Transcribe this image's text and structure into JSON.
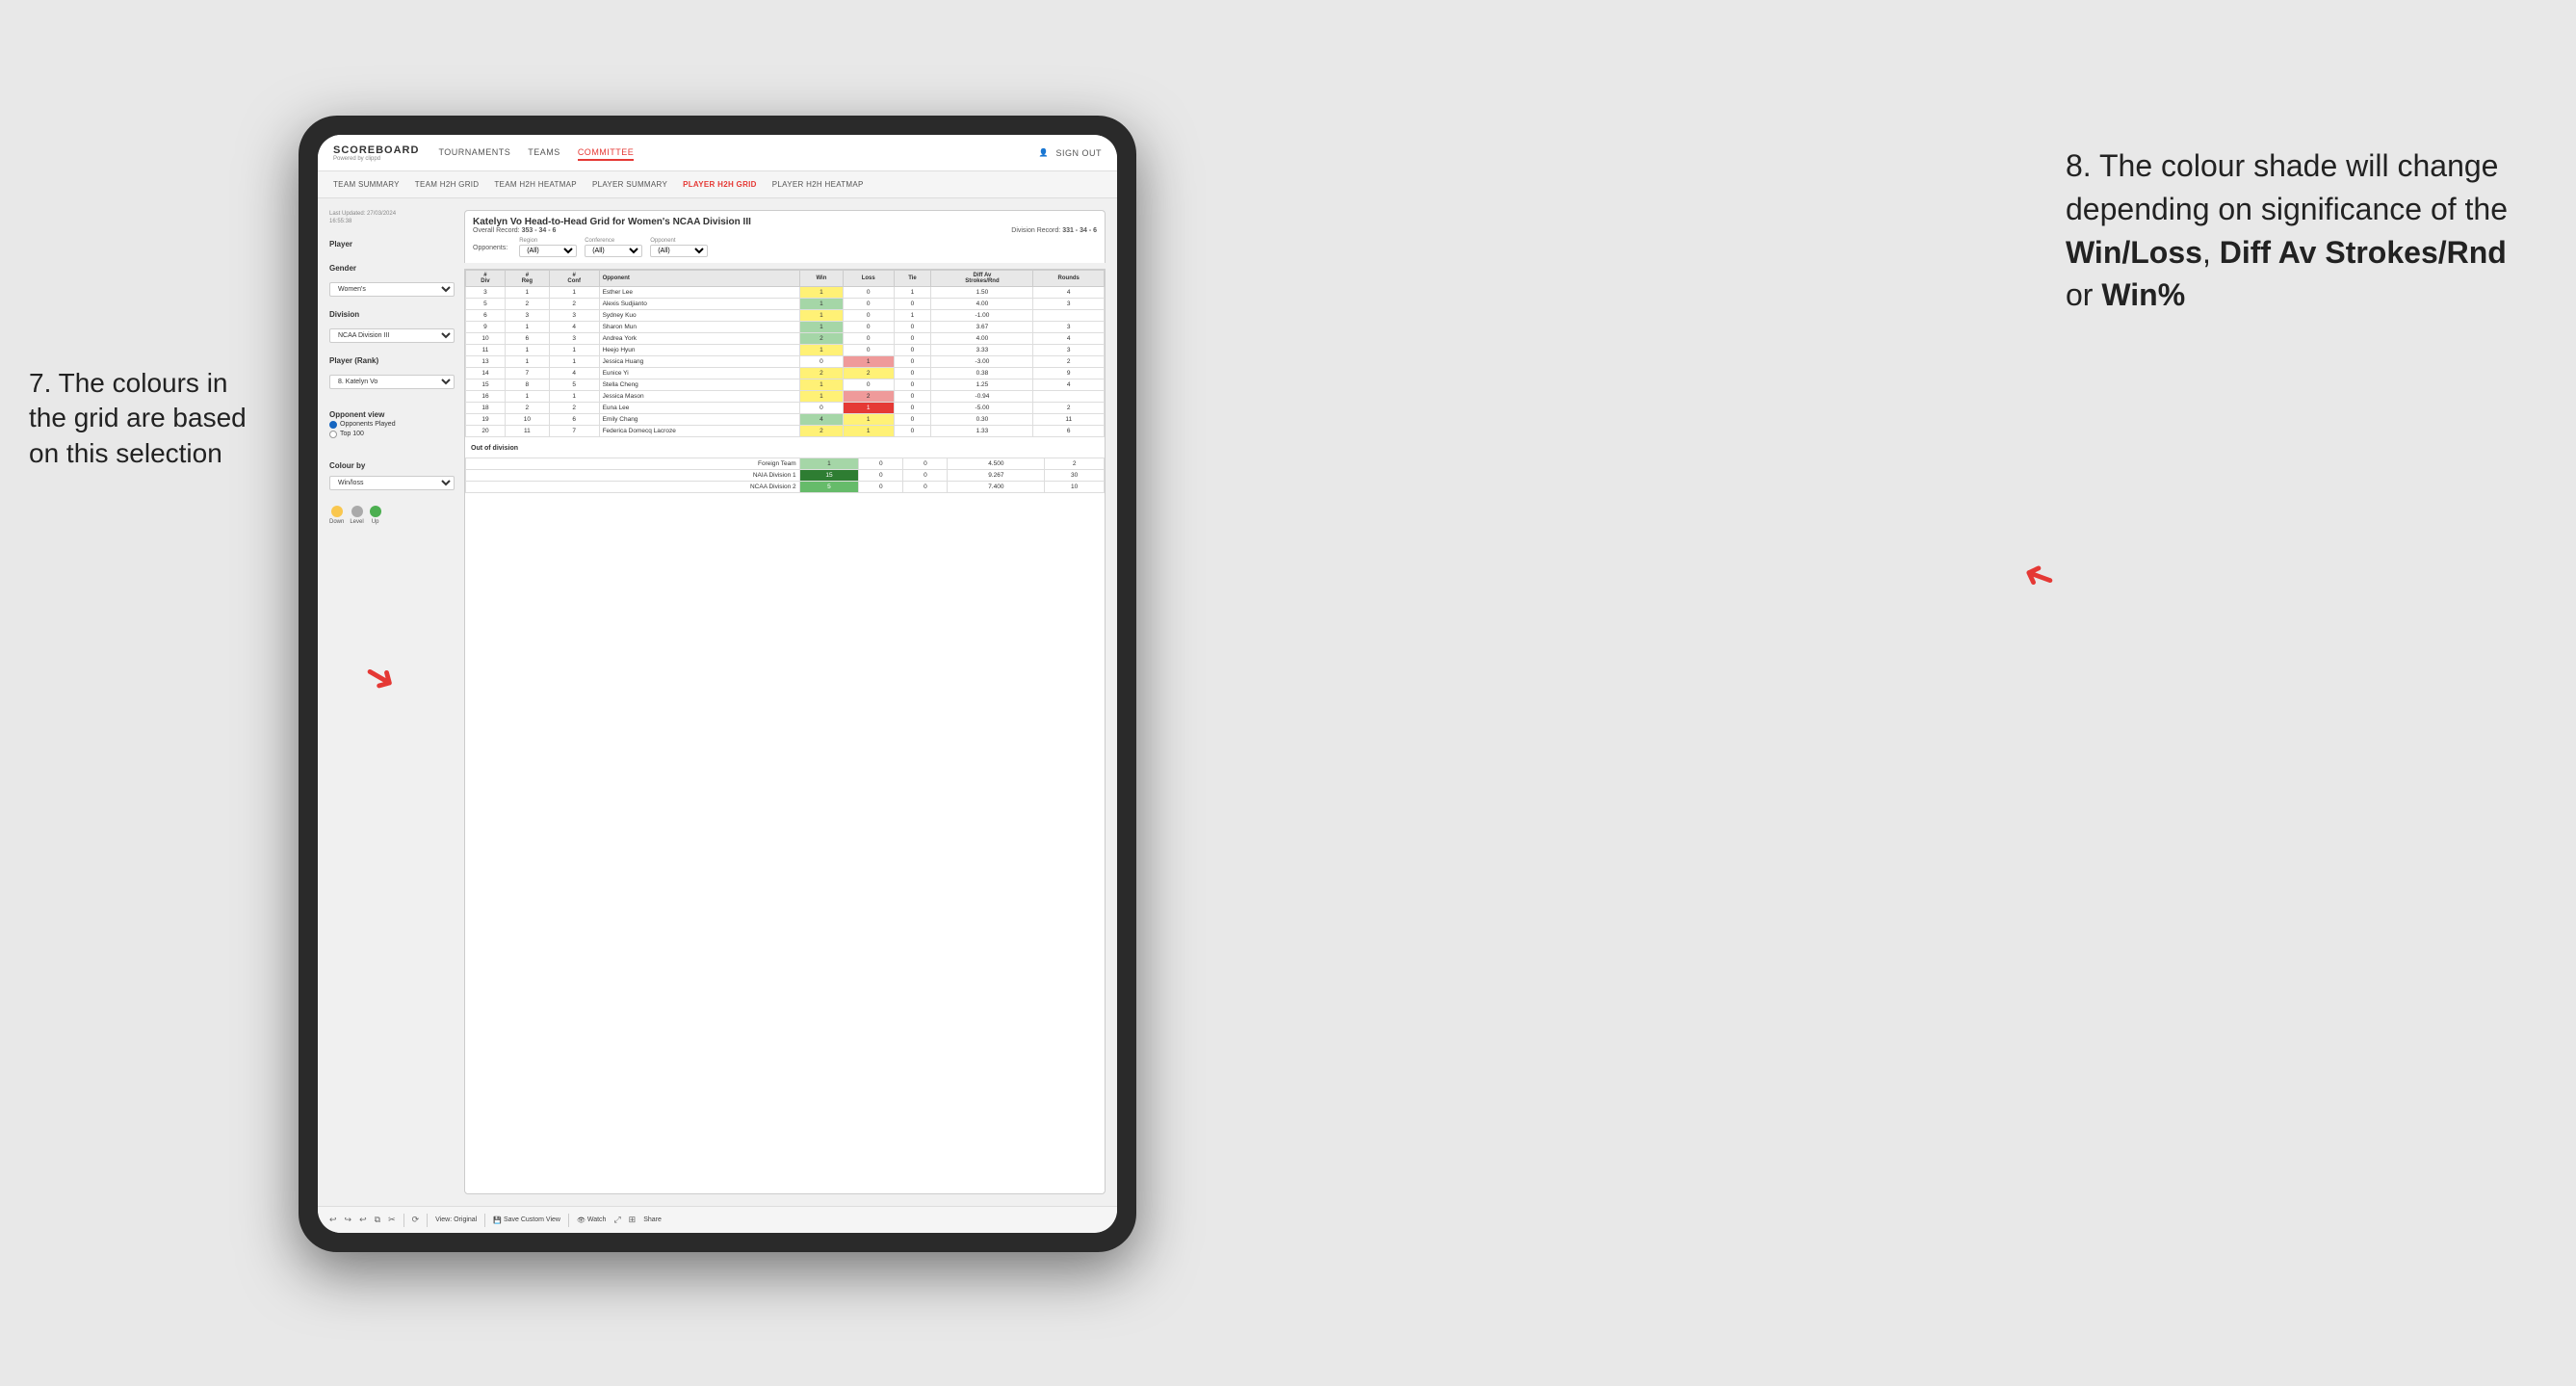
{
  "annotations": {
    "left": {
      "line1": "7. The colours in",
      "line2": "the grid are based",
      "line3": "on this selection"
    },
    "right": {
      "intro": "8. The colour shade will change depending on significance of the ",
      "bold1": "Win/Loss",
      "sep1": ", ",
      "bold2": "Diff Av Strokes/Rnd",
      "sep2": " or ",
      "bold3": "Win%"
    }
  },
  "header": {
    "logo": "SCOREBOARD",
    "logo_sub": "Powered by clippd",
    "nav": [
      "TOURNAMENTS",
      "TEAMS",
      "COMMITTEE"
    ],
    "active_nav": "COMMITTEE",
    "sign_in_label": "Sign out"
  },
  "sub_nav": {
    "items": [
      "TEAM SUMMARY",
      "TEAM H2H GRID",
      "TEAM H2H HEATMAP",
      "PLAYER SUMMARY",
      "PLAYER H2H GRID",
      "PLAYER H2H HEATMAP"
    ],
    "active": "PLAYER H2H GRID"
  },
  "left_panel": {
    "last_updated": "Last Updated: 27/03/2024\n16:55:38",
    "player_label": "Player",
    "gender_label": "Gender",
    "gender_value": "Women's",
    "division_label": "Division",
    "division_value": "NCAA Division III",
    "player_rank_label": "Player (Rank)",
    "player_rank_value": "8. Katelyn Vo",
    "opponent_view_label": "Opponent view",
    "radio1": "Opponents Played",
    "radio2": "Top 100",
    "colour_by_label": "Colour by",
    "colour_by_value": "Win/loss",
    "legend": {
      "down_label": "Down",
      "level_label": "Level",
      "up_label": "Up",
      "down_color": "#f9c74f",
      "level_color": "#aaa",
      "up_color": "#4caf50"
    }
  },
  "grid": {
    "title": "Katelyn Vo Head-to-Head Grid for Women's NCAA Division III",
    "overall_record_label": "Overall Record:",
    "overall_record": "353 - 34 - 6",
    "division_record_label": "Division Record:",
    "division_record": "331 - 34 - 6",
    "filters": {
      "opponents_label": "Opponents:",
      "region_label": "Region",
      "region_value": "(All)",
      "conference_label": "Conference",
      "conference_value": "(All)",
      "opponent_label": "Opponent",
      "opponent_value": "(All)"
    },
    "table_headers": [
      "#\nDiv",
      "#\nReg",
      "#\nConf",
      "Opponent",
      "Win",
      "Loss",
      "Tie",
      "Diff Av\nStrokes/Rnd",
      "Rounds"
    ],
    "rows": [
      {
        "div": "3",
        "reg": "1",
        "conf": "1",
        "opponent": "Esther Lee",
        "win": 1,
        "loss": 0,
        "tie": 1,
        "diff": "1.50",
        "rounds": "4",
        "win_class": "cell-yellow",
        "loss_class": "cell-empty"
      },
      {
        "div": "5",
        "reg": "2",
        "conf": "2",
        "opponent": "Alexis Sudjianto",
        "win": 1,
        "loss": 0,
        "tie": 0,
        "diff": "4.00",
        "rounds": "3",
        "win_class": "cell-green-light",
        "loss_class": "cell-empty"
      },
      {
        "div": "6",
        "reg": "3",
        "conf": "3",
        "opponent": "Sydney Kuo",
        "win": 1,
        "loss": 0,
        "tie": 1,
        "diff": "-1.00",
        "rounds": "",
        "win_class": "cell-yellow",
        "loss_class": "cell-empty"
      },
      {
        "div": "9",
        "reg": "1",
        "conf": "4",
        "opponent": "Sharon Mun",
        "win": 1,
        "loss": 0,
        "tie": 0,
        "diff": "3.67",
        "rounds": "3",
        "win_class": "cell-green-light",
        "loss_class": "cell-empty"
      },
      {
        "div": "10",
        "reg": "6",
        "conf": "3",
        "opponent": "Andrea York",
        "win": 2,
        "loss": 0,
        "tie": 0,
        "diff": "4.00",
        "rounds": "4",
        "win_class": "cell-green-light",
        "loss_class": "cell-empty"
      },
      {
        "div": "11",
        "reg": "1",
        "conf": "1",
        "opponent": "Heejo Hyun",
        "win": 1,
        "loss": 0,
        "tie": 0,
        "diff": "3.33",
        "rounds": "3",
        "win_class": "cell-yellow",
        "loss_class": "cell-empty"
      },
      {
        "div": "13",
        "reg": "1",
        "conf": "1",
        "opponent": "Jessica Huang",
        "win": 0,
        "loss": 1,
        "tie": 0,
        "diff": "-3.00",
        "rounds": "2",
        "win_class": "cell-empty",
        "loss_class": "cell-red-light"
      },
      {
        "div": "14",
        "reg": "7",
        "conf": "4",
        "opponent": "Eunice Yi",
        "win": 2,
        "loss": 2,
        "tie": 0,
        "diff": "0.38",
        "rounds": "9",
        "win_class": "cell-yellow",
        "loss_class": "cell-yellow"
      },
      {
        "div": "15",
        "reg": "8",
        "conf": "5",
        "opponent": "Stella Cheng",
        "win": 1,
        "loss": 0,
        "tie": 0,
        "diff": "1.25",
        "rounds": "4",
        "win_class": "cell-yellow",
        "loss_class": "cell-empty"
      },
      {
        "div": "16",
        "reg": "1",
        "conf": "1",
        "opponent": "Jessica Mason",
        "win": 1,
        "loss": 2,
        "tie": 0,
        "diff": "-0.94",
        "rounds": "",
        "win_class": "cell-yellow",
        "loss_class": "cell-red-light"
      },
      {
        "div": "18",
        "reg": "2",
        "conf": "2",
        "opponent": "Euna Lee",
        "win": 0,
        "loss": 1,
        "tie": 0,
        "diff": "-5.00",
        "rounds": "2",
        "win_class": "cell-empty",
        "loss_class": "cell-red-mid"
      },
      {
        "div": "19",
        "reg": "10",
        "conf": "6",
        "opponent": "Emily Chang",
        "win": 4,
        "loss": 1,
        "tie": 0,
        "diff": "0.30",
        "rounds": "11",
        "win_class": "cell-green-light",
        "loss_class": "cell-yellow"
      },
      {
        "div": "20",
        "reg": "11",
        "conf": "7",
        "opponent": "Federica Domecq Lacroze",
        "win": 2,
        "loss": 1,
        "tie": 0,
        "diff": "1.33",
        "rounds": "6",
        "win_class": "cell-yellow",
        "loss_class": "cell-yellow"
      }
    ],
    "out_of_division_label": "Out of division",
    "out_of_division_rows": [
      {
        "name": "Foreign Team",
        "win": 1,
        "loss": 0,
        "tie": 0,
        "diff": "4.500",
        "rounds": "2",
        "win_class": "cell-green-light"
      },
      {
        "name": "NAIA Division 1",
        "win": 15,
        "loss": 0,
        "tie": 0,
        "diff": "9.267",
        "rounds": "30",
        "win_class": "cell-green-dark"
      },
      {
        "name": "NCAA Division 2",
        "win": 5,
        "loss": 0,
        "tie": 0,
        "diff": "7.400",
        "rounds": "10",
        "win_class": "cell-green-mid"
      }
    ]
  },
  "toolbar": {
    "view_original": "View: Original",
    "save_custom": "Save Custom View",
    "watch": "Watch",
    "share": "Share"
  }
}
